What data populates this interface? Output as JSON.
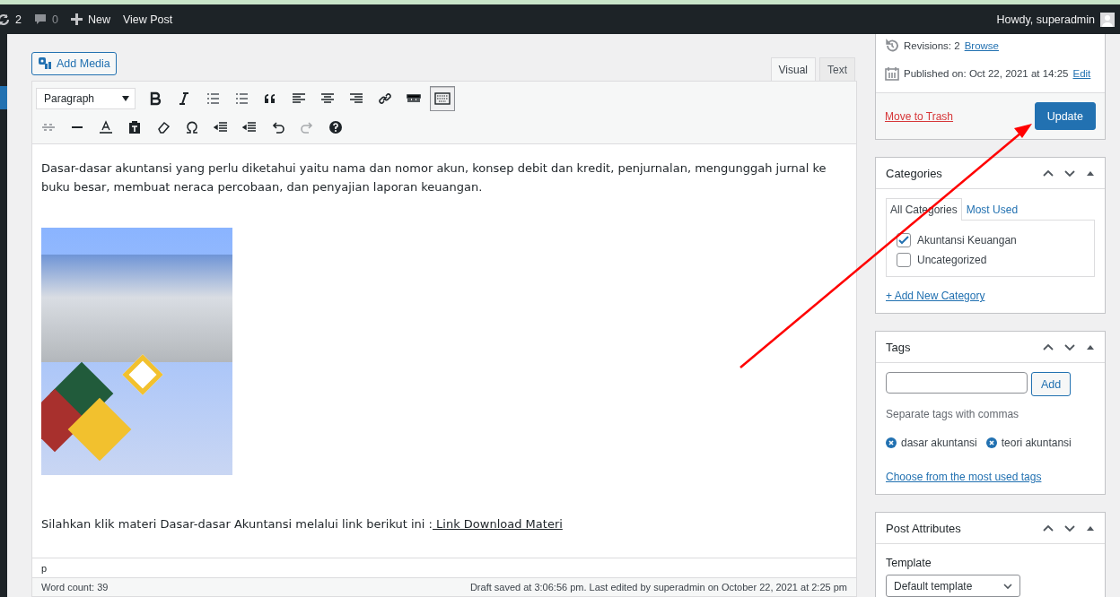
{
  "admin_bar": {
    "updates_count": "2",
    "comments_count": "0",
    "new_label": "New",
    "view_post": "View Post",
    "greeting": "Howdy, superadmin"
  },
  "editor": {
    "add_media": "Add Media",
    "tabs": [
      {
        "label": "Visual",
        "selected": true
      },
      {
        "label": "Text",
        "selected": false
      }
    ],
    "format_select": "Paragraph",
    "toolbar_toggle_active": true,
    "paragraph_1": "Dasar-dasar akuntansi yang perlu diketahui yaitu nama dan nomor akun, konsep debit dan kredit, penjurnalan, mengunggah jurnal ke buku besar, membuat neraca percobaan, dan penyajian laporan keuangan.",
    "paragraph_2": "Silahkan klik materi Dasar-dasar Akuntansi melalui link berikut ini :",
    "paragraph_2_link": " Link Download Materi",
    "path": "p",
    "word_count": "Word count: 39",
    "draft_status": "Draft saved at 3:06:56 pm. Last edited by superadmin on October 22, 2021 at 2:25 pm"
  },
  "publish": {
    "revisions_label": "Revisions: 2",
    "browse": "Browse",
    "published_label": "Published on: Oct 22, 2021 at 14:25",
    "edit": "Edit",
    "trash": "Move to Trash",
    "update": "Update"
  },
  "categories": {
    "title": "Categories",
    "tabs": [
      {
        "label": "All Categories",
        "selected": true
      },
      {
        "label": "Most Used",
        "selected": false
      }
    ],
    "items": [
      {
        "label": "Akuntansi Keuangan",
        "checked": true
      },
      {
        "label": "Uncategorized",
        "checked": false
      }
    ],
    "add_new": "+ Add New Category"
  },
  "tags": {
    "title": "Tags",
    "add": "Add",
    "hint": "Separate tags with commas",
    "items": [
      "dasar akuntansi",
      "teori akuntansi"
    ],
    "choose": "Choose from the most used tags"
  },
  "post_attributes": {
    "title": "Post Attributes",
    "template_label": "Template",
    "template_value": "Default template"
  }
}
